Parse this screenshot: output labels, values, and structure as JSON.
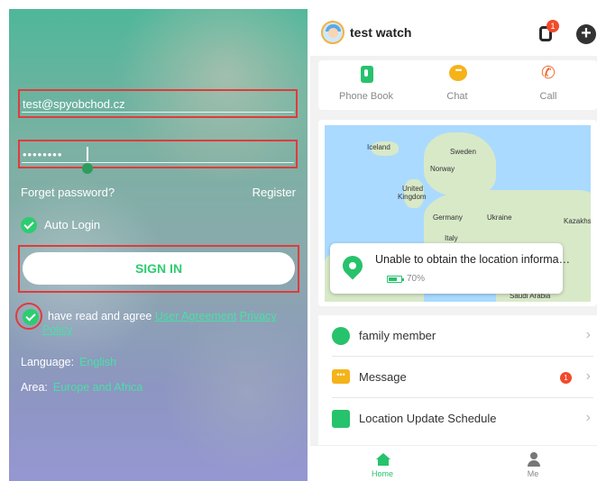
{
  "login": {
    "email_value": "test@spyobchod.cz",
    "password_value": "••••••••",
    "forget_password": "Forget password?",
    "register": "Register",
    "auto_login": "Auto Login",
    "sign_in": "SIGN IN",
    "agree_prefix": "have read and agree",
    "user_agreement": "User Agreement",
    "privacy_policy_part1": "Privacy",
    "privacy_policy_part2": "Policy",
    "language_label": "Language:",
    "language_value": "English",
    "area_label": "Area:",
    "area_value": "Europe and Africa"
  },
  "app": {
    "device_name": "test watch",
    "watch_badge": "1",
    "quick_actions": [
      {
        "label": "Phone Book",
        "icon": "phone-book-icon"
      },
      {
        "label": "Chat",
        "icon": "chat-icon"
      },
      {
        "label": "Call",
        "icon": "call-icon"
      }
    ],
    "map_labels": {
      "iceland": "Iceland",
      "sweden": "Sweden",
      "norway": "Norway",
      "united": "United",
      "kingdom": "Kingdom",
      "germany": "Germany",
      "ukraine": "Ukraine",
      "kazakhs": "Kazakhs",
      "italy": "Italy",
      "saudi": "Saudi Arabia"
    },
    "location_status": "Unable to obtain the location information",
    "battery_percent": "70%",
    "battery_level": 0.7,
    "menu": [
      {
        "label": "family member",
        "icon": "family-member-icon"
      },
      {
        "label": "Message",
        "icon": "message-icon",
        "badge": "1"
      },
      {
        "label": "Location Update Schedule",
        "icon": "schedule-icon"
      }
    ],
    "tabs": {
      "home": "Home",
      "me": "Me"
    }
  },
  "colors": {
    "accent_green": "#27c26c",
    "highlight_red": "#e23a3a",
    "badge_red": "#f24a2b",
    "link_green": "#48e0a6"
  }
}
